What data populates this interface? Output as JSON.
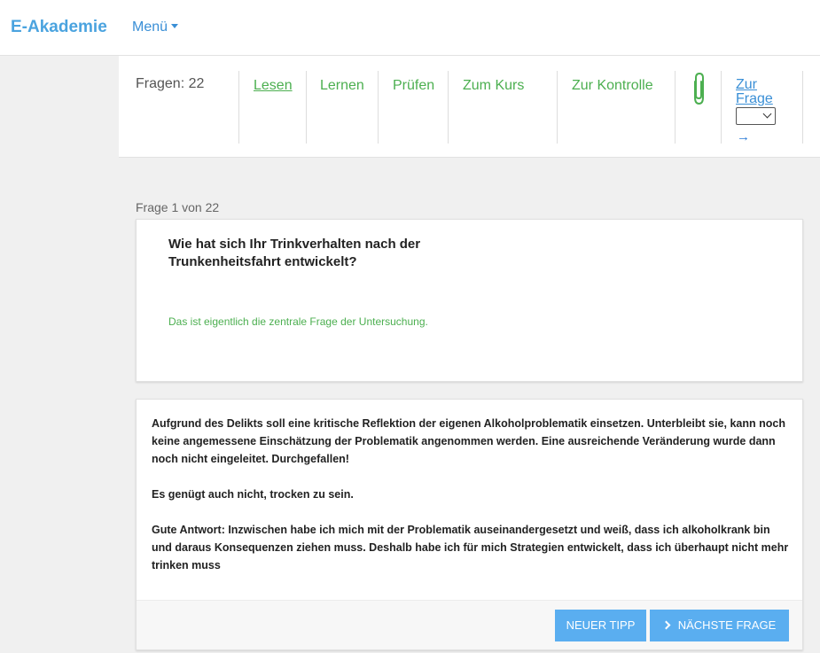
{
  "navbar": {
    "brand": "E-Akademie",
    "menu_label": "Menü"
  },
  "toolbar": {
    "count_label": "Fragen: 22",
    "links": [
      {
        "label": "Lesen",
        "active": true
      },
      {
        "label": "Lernen"
      },
      {
        "label": "Prüfen"
      },
      {
        "label": "Zum Kurs"
      },
      {
        "label": "Zur Kontrolle"
      }
    ],
    "attachment_icon": "paperclip-icon",
    "goto_line1": "Zur",
    "goto_line2": "Frage",
    "goto_arrow": "→"
  },
  "question": {
    "number_label": "Frage 1 von 22",
    "title": "Wie hat sich Ihr Trinkverhalten nach der Trunkenheitsfahrt entwickelt?",
    "note": "Das ist eigentlich die zentrale Frage der Untersuchung."
  },
  "answer": {
    "paragraphs": [
      "Aufgrund des Delikts soll eine kritische Reflektion der eigenen Alkoholproblematik einsetzen. Unterbleibt sie, kann noch keine angemessene Einschätzung der Problematik angenommen werden. Eine ausreichende Veränderung wurde dann noch nicht eingeleitet. Durchgefallen!",
      "Es genügt auch nicht, trocken zu sein.",
      "Gute Antwort: Inzwischen habe ich mich mit der Problematik auseinandergesetzt und weiß, dass ich alkoholkrank bin und daraus Konsequenzen ziehen muss. Deshalb habe ich für mich Strategien entwickelt, dass ich überhaupt nicht mehr trinken muss"
    ],
    "btn_tipp": "NEUER TIPP",
    "btn_next": "NÄCHSTE FRAGE"
  },
  "colors": {
    "brand": "#4aa3df",
    "link_green": "#4caf50",
    "button_blue": "#5aaef0"
  }
}
